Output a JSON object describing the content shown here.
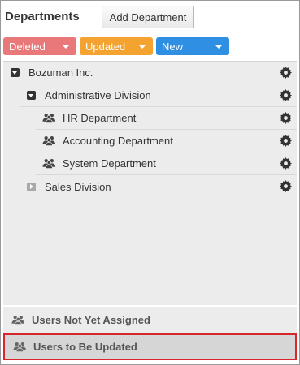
{
  "header": {
    "title": "Departments",
    "add_button": "Add Department"
  },
  "filters": [
    {
      "label": "Deleted",
      "color": "#e8787a"
    },
    {
      "label": "Updated",
      "color": "#f5a330"
    },
    {
      "label": "New",
      "color": "#2f8fe3"
    }
  ],
  "tree": {
    "items": [
      {
        "label": "Bozuman Inc.",
        "expanded": true,
        "icon": "collapse-toggle-icon"
      },
      {
        "label": "Administrative Division",
        "expanded": true,
        "icon": "collapse-toggle-icon"
      },
      {
        "label": "HR Department",
        "icon": "group-icon"
      },
      {
        "label": "Accounting Department",
        "icon": "group-icon"
      },
      {
        "label": "System Department",
        "icon": "group-icon"
      },
      {
        "label": "Sales Division",
        "expanded": false,
        "icon": "expand-toggle-icon"
      }
    ]
  },
  "bottom": {
    "unassigned": "Users Not Yet Assigned",
    "to_update": "Users to Be Updated"
  },
  "colors": {
    "selected_outline": "#d8262c"
  }
}
